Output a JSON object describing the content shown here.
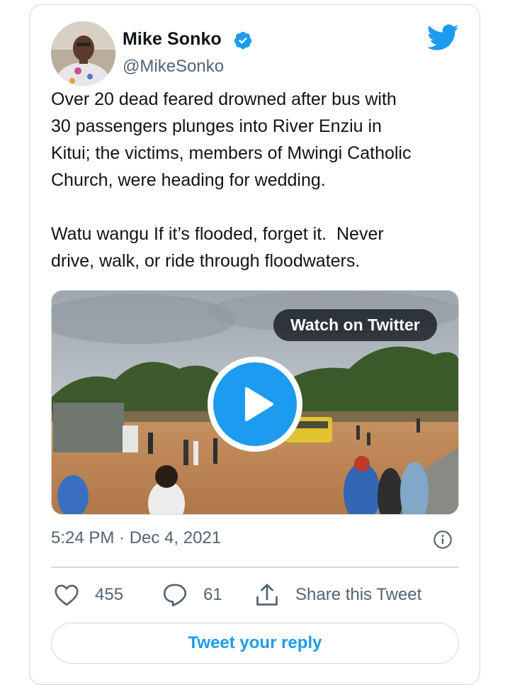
{
  "author": {
    "name": "Mike Sonko",
    "handle": "@MikeSonko",
    "avatar_icon": "avatar-photo",
    "verified_icon": "verified-badge-icon"
  },
  "brand": {
    "icon": "twitter-bird-icon",
    "color": "#1d9bf0"
  },
  "tweet": {
    "text": "Over 20 dead feared drowned after bus with\n30 passengers plunges into River Enziu in\nKitui; the victims, members of Mwingi Catholic\nChurch, were heading for wedding.\n\nWatu wangu If it’s flooded, forget it.  Never\ndrive, walk, or ride through floodwaters.",
    "timestamp": "5:24 PM · Dec 4, 2021"
  },
  "media": {
    "watch_label": "Watch on Twitter",
    "play_icon": "play-icon"
  },
  "actions": {
    "like_count": "455",
    "reply_count": "61",
    "share_label": "Share this Tweet"
  },
  "reply_button_label": "Tweet your reply",
  "colors": {
    "text": "#0f1419",
    "secondary": "#536471",
    "border": "#cfd9de",
    "accent": "#1d9bf0"
  }
}
